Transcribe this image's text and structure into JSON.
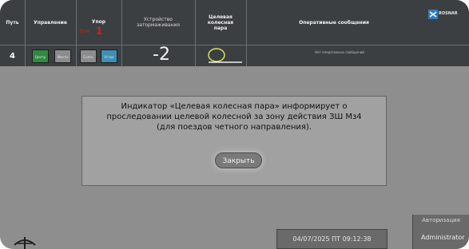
{
  "columns": {
    "way": "Путь",
    "control": "Управление",
    "stop": "Упор",
    "device": "Устройство\nзатормаживания",
    "wheel_pair": "Целевая\nколесная\nпара",
    "messages": "Оперативные сообщения"
  },
  "row": {
    "way_number": "4",
    "control_buttons": [
      {
        "label": "Центр",
        "color": "#2f8a3f"
      },
      {
        "label": "Местн",
        "color": "#8a8c8e"
      },
      {
        "label": "Снять",
        "color": "#8a8c8e"
      },
      {
        "label": "Устан",
        "color": "#3f8fb3"
      }
    ],
    "stop_label": "Отк",
    "stop_value": "1",
    "device_value": "-2",
    "message": "Нет оперативных сообщений"
  },
  "dialog": {
    "text": "Индикатор «Целевая колесная пара» информирует о\nпроследовании целевой колесной за зону действия ЗШ Мз4\n(для поездов четного направления).",
    "close_label": "Закрыть"
  },
  "status": {
    "datetime": "04/07/2025 ПТ 09:12:38",
    "auth_title": "Авторизация",
    "user": "Administrator"
  },
  "brand": {
    "name": "ROSNAR"
  },
  "icons": [
    "wheel-pair-icon",
    "brand-logo-icon",
    "railway-logo-icon"
  ]
}
